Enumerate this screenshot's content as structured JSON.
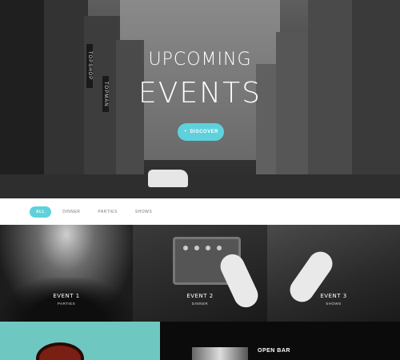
{
  "hero": {
    "title_line1": "UPCOMING",
    "title_line2": "EVENTS",
    "discover_label": "DISCOVER",
    "signs": [
      "TOPSHOP",
      "TOPMAN"
    ]
  },
  "filters": {
    "items": [
      {
        "label": "ALL",
        "active": true
      },
      {
        "label": "DINNER",
        "active": false
      },
      {
        "label": "PARTIES",
        "active": false
      },
      {
        "label": "SHOWS",
        "active": false
      }
    ]
  },
  "events": [
    {
      "title": "EVENT 1",
      "category": "PARTIES"
    },
    {
      "title": "EVENT 2",
      "category": "DINNER"
    },
    {
      "title": "EVENT 3",
      "category": "SHOWS"
    }
  ],
  "bottom": {
    "open_bar_title": "OPEN BAR"
  },
  "colors": {
    "accent": "#5ed1dc",
    "teal_panel": "#6fc7c1"
  }
}
